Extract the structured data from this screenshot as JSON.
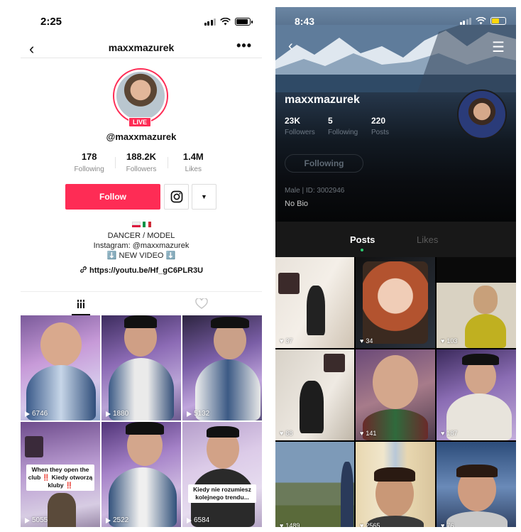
{
  "left": {
    "status": {
      "time": "2:25"
    },
    "nav": {
      "back": "‹",
      "username": "maxxmazurek",
      "more": "•••"
    },
    "live_badge": "LIVE",
    "handle": "@maxxmazurek",
    "stats": [
      {
        "value": "178",
        "label": "Following"
      },
      {
        "value": "188.2K",
        "label": "Followers"
      },
      {
        "value": "1.4M",
        "label": "Likes"
      }
    ],
    "follow_label": "Follow",
    "dropdown_glyph": "▼",
    "bio": {
      "line1": "DANCER / MODEL",
      "line2": "Instagram: @maxxmazurek",
      "line3": "⬇️ NEW VIDEO ⬇️",
      "link": "https://youtu.be/Hf_gC6PLR3U"
    },
    "videos": [
      {
        "views": "6746",
        "caption": ""
      },
      {
        "views": "1880",
        "caption": ""
      },
      {
        "views": "5132",
        "caption": ""
      },
      {
        "views": "5055",
        "caption": "When they open the club ‼️ Kiedy otworzą kluby ‼️"
      },
      {
        "views": "2522",
        "caption": ""
      },
      {
        "views": "6584",
        "caption": "Kiedy nie rozumiesz kolejnego trendu..."
      }
    ]
  },
  "right": {
    "status": {
      "time": "8:43"
    },
    "username": "maxxmazurek",
    "stats": [
      {
        "value": "23K",
        "label": "Followers"
      },
      {
        "value": "5",
        "label": "Following"
      },
      {
        "value": "220",
        "label": "Posts"
      }
    ],
    "following_label": "Following",
    "id_line": "Male | ID: 3002946",
    "bio": "No Bio",
    "tabs": {
      "posts": "Posts",
      "likes": "Likes"
    },
    "posts": [
      {
        "likes": "37"
      },
      {
        "likes": "34"
      },
      {
        "likes": "103"
      },
      {
        "likes": "88"
      },
      {
        "likes": "141"
      },
      {
        "likes": "187"
      },
      {
        "likes": "1489"
      },
      {
        "likes": "2565"
      },
      {
        "likes": "76"
      }
    ]
  },
  "colors": {
    "accent": "#fe2c55",
    "dark_bg": "#000000",
    "tab_bar": "#181818",
    "indicator": "#2ecc71"
  }
}
